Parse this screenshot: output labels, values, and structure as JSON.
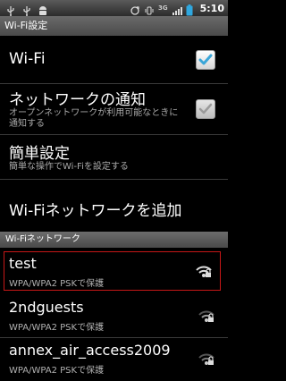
{
  "status_bar": {
    "icons": [
      "usb-icon",
      "usb-debug-icon",
      "android-icon",
      "sync-icon",
      "vibrate-icon",
      "3g-signal-icon",
      "battery-icon"
    ],
    "network": "3G",
    "time": "5:10"
  },
  "title": "Wi-Fi設定",
  "rows": {
    "wifi": {
      "title": "Wi-Fi",
      "checked": true
    },
    "notify": {
      "title": "ネットワークの通知",
      "subtitle": "オープンネットワークが利用可能なときに通知する",
      "checked": true
    },
    "easy": {
      "title": "簡単設定",
      "subtitle": "簡単な操作でWi-Fiを設定する"
    },
    "add": {
      "title": "Wi-Fiネットワークを追加"
    }
  },
  "section_header": "Wi-Fiネットワーク",
  "networks": [
    {
      "name": "test",
      "security": "WPA/WPA2 PSKで保護",
      "selected": true
    },
    {
      "name": "2ndguests",
      "security": "WPA/WPA2 PSKで保護"
    },
    {
      "name": "annex_air_access2009",
      "security": "WPA/WPA2 PSKで保護"
    }
  ],
  "colors": {
    "check": "#3aa6d8",
    "selection_border": "#c71717"
  }
}
